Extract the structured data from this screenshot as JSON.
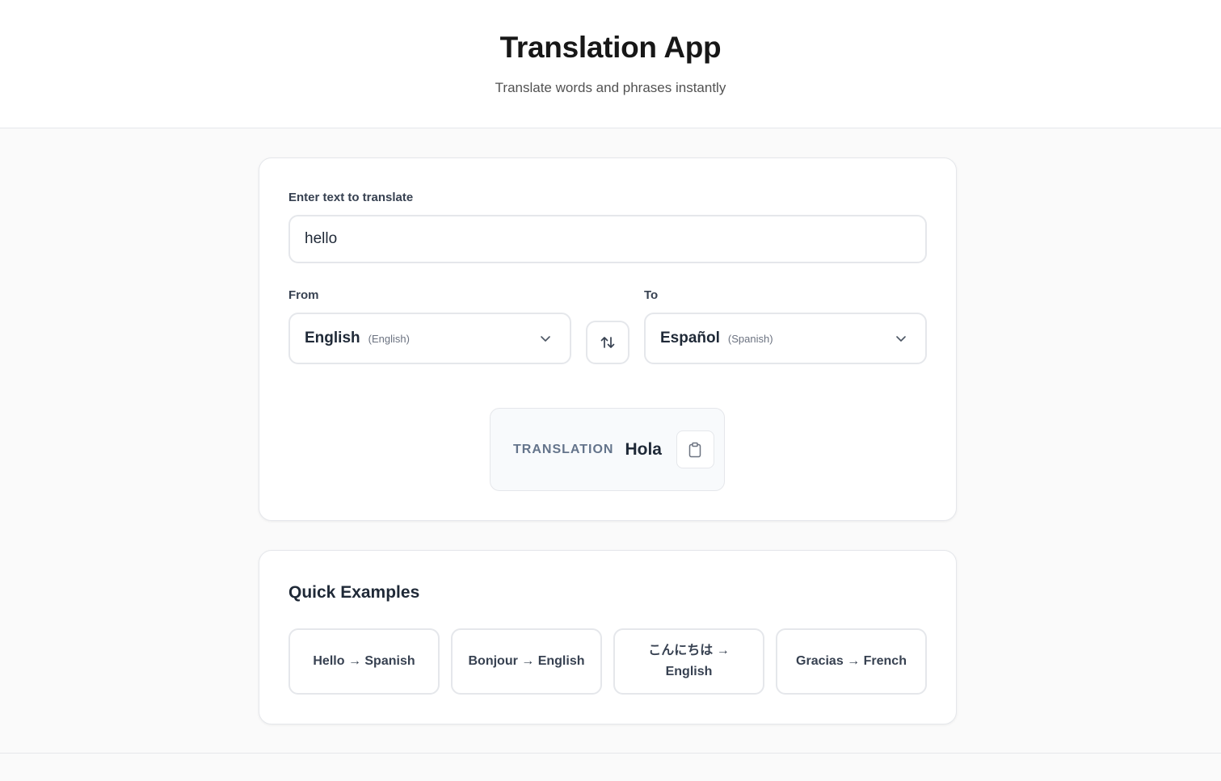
{
  "header": {
    "title": "Translation App",
    "subtitle": "Translate words and phrases instantly"
  },
  "translator": {
    "input_label": "Enter text to translate",
    "input_value": "hello",
    "from_label": "From",
    "to_label": "To",
    "from": {
      "native": "English",
      "english": "(English)"
    },
    "to": {
      "native": "Español",
      "english": "(Spanish)"
    },
    "result_label": "TRANSLATION",
    "result_value": "Hola"
  },
  "examples": {
    "title": "Quick Examples",
    "items": [
      {
        "label": "Hello → Spanish"
      },
      {
        "label": "Bonjour → English"
      },
      {
        "label": "こんにちは → English"
      },
      {
        "label": "Gracias → French"
      }
    ]
  },
  "icons": {
    "chevron": "chevron-down-icon",
    "swap": "swap-vertical-icon",
    "copy": "clipboard-icon"
  },
  "colors": {
    "border": "#e5e7eb",
    "background": "#fafafa",
    "result_bg": "#f8fafc",
    "result_label": "#64748b"
  }
}
